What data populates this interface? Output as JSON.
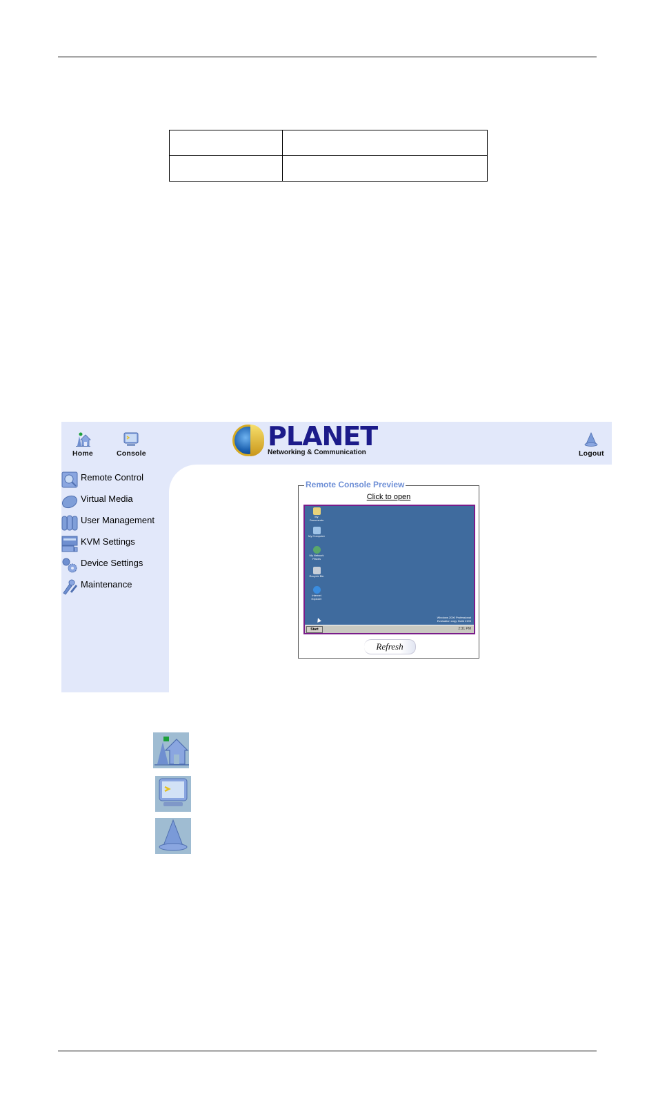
{
  "document": {
    "table": {
      "rows": [
        [
          "",
          ""
        ],
        [
          "",
          ""
        ]
      ]
    }
  },
  "ui": {
    "toolbar": {
      "home_label": "Home",
      "console_label": "Console",
      "logout_label": "Logout"
    },
    "logo": {
      "brand": "PLANET",
      "tagline": "Networking & Communication"
    },
    "sidebar": {
      "items": [
        {
          "label": "Remote Control",
          "icon": "remote-control-icon"
        },
        {
          "label": "Virtual Media",
          "icon": "virtual-media-icon"
        },
        {
          "label": "User Management",
          "icon": "user-management-icon"
        },
        {
          "label": "KVM Settings",
          "icon": "kvm-settings-icon"
        },
        {
          "label": "Device Settings",
          "icon": "device-settings-icon"
        },
        {
          "label": "Maintenance",
          "icon": "maintenance-icon"
        }
      ]
    },
    "preview": {
      "title": "Remote Console Preview",
      "open_link": "Click to open",
      "refresh_label": "Refresh",
      "desktop": {
        "icons": [
          "My Documents",
          "My Computer",
          "My Network Places",
          "Recycle Bin",
          "Internet Explorer"
        ],
        "watermark_line1": "Windows 2000 Professional",
        "watermark_line2": "Evaluation copy. Build 2195",
        "start_label": "Start",
        "clock": "2:31 PM"
      }
    },
    "colors": {
      "panel_bg": "#e2e8fa",
      "brand": "#1c1b8a",
      "legend": "#6e8fd6",
      "desktop_bg": "#3f6b9e",
      "desktop_border": "#7a1c8a"
    }
  },
  "legend_icons": [
    "home-icon",
    "console-icon",
    "logout-icon"
  ]
}
